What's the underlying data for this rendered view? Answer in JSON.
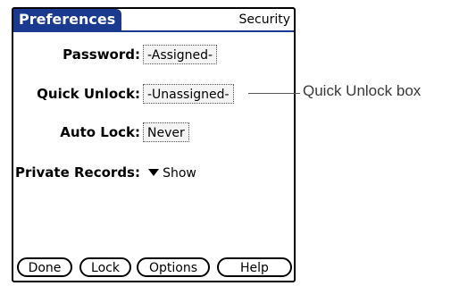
{
  "header": {
    "app_title": "Preferences",
    "category": "Security"
  },
  "fields": {
    "password": {
      "label": "Password:",
      "value": "-Assigned-"
    },
    "quick_unlock": {
      "label": "Quick Unlock:",
      "value": "-Unassigned-"
    },
    "auto_lock": {
      "label": "Auto Lock:",
      "value": "Never"
    },
    "private_records": {
      "label": "Private Records:",
      "value": "Show"
    }
  },
  "buttons": {
    "done": "Done",
    "lock": "Lock",
    "options": "Options",
    "help": "Help"
  },
  "callout": {
    "text": "Quick Unlock box"
  },
  "colors": {
    "title_bg": "#1a3a8f"
  }
}
